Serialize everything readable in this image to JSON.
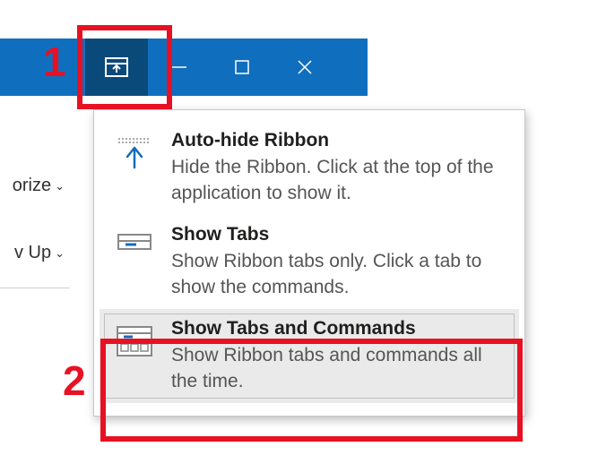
{
  "titlebar": {
    "ribbon_options_name": "ribbon-display-options",
    "minimize_name": "minimize",
    "maximize_name": "maximize",
    "close_name": "close"
  },
  "ribbon_partial": {
    "items": [
      {
        "label": "orize"
      },
      {
        "label": "v Up"
      }
    ]
  },
  "menu": {
    "items": [
      {
        "title": "Auto-hide Ribbon",
        "desc": "Hide the Ribbon. Click at the top of the application to show it."
      },
      {
        "title": "Show Tabs",
        "desc": "Show Ribbon tabs only. Click a tab to show the commands."
      },
      {
        "title": "Show Tabs and Commands",
        "desc": "Show Ribbon tabs and commands all the time."
      }
    ]
  },
  "annotations": {
    "num1": "1",
    "num2": "2"
  }
}
